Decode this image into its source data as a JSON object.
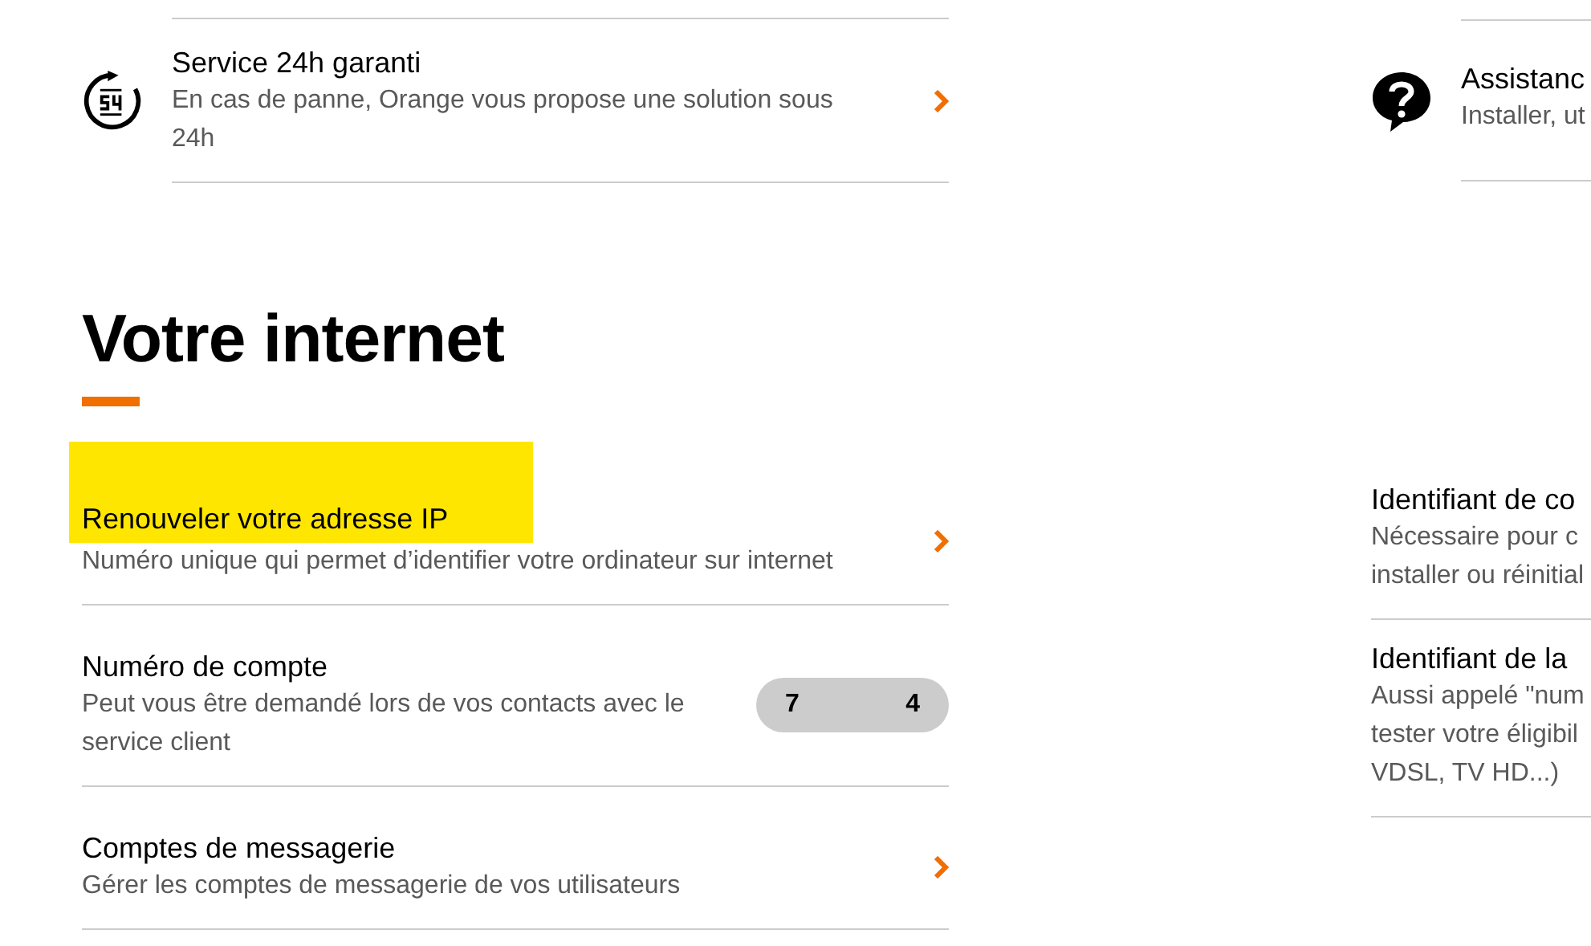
{
  "top_services": [
    {
      "kind": "clock",
      "title": "Service 24h garanti",
      "description": "En cas de panne, Orange vous propose une solution sous 24h"
    },
    {
      "kind": "help",
      "title": "Assistanc",
      "description_lines": [
        "Installer, ut"
      ]
    }
  ],
  "section": {
    "title": "Votre internet"
  },
  "internet_items": [
    {
      "title": "Renouveler votre adresse IP",
      "highlighted": true,
      "description": "Numéro unique qui permet d’identifier votre ordinateur sur internet",
      "kind": "link"
    },
    {
      "title": "Numéro de compte",
      "highlighted": false,
      "description": "Peut vous être demandé lors de vos contacts avec le service client",
      "kind": "value",
      "badge": [
        "7",
        "4"
      ]
    },
    {
      "title": "Comptes de messagerie",
      "highlighted": false,
      "description": "Gérer les comptes de messagerie de vos utilisateurs",
      "kind": "link"
    }
  ],
  "right_items": [
    {
      "title": "Identifiant de co",
      "description_lines": [
        "Nécessaire pour c",
        "installer ou réinitial"
      ]
    },
    {
      "title": "Identifiant de la",
      "description_lines": [
        "Aussi appelé \"num",
        "tester votre éligibil",
        "VDSL, TV HD...)"
      ]
    }
  ]
}
